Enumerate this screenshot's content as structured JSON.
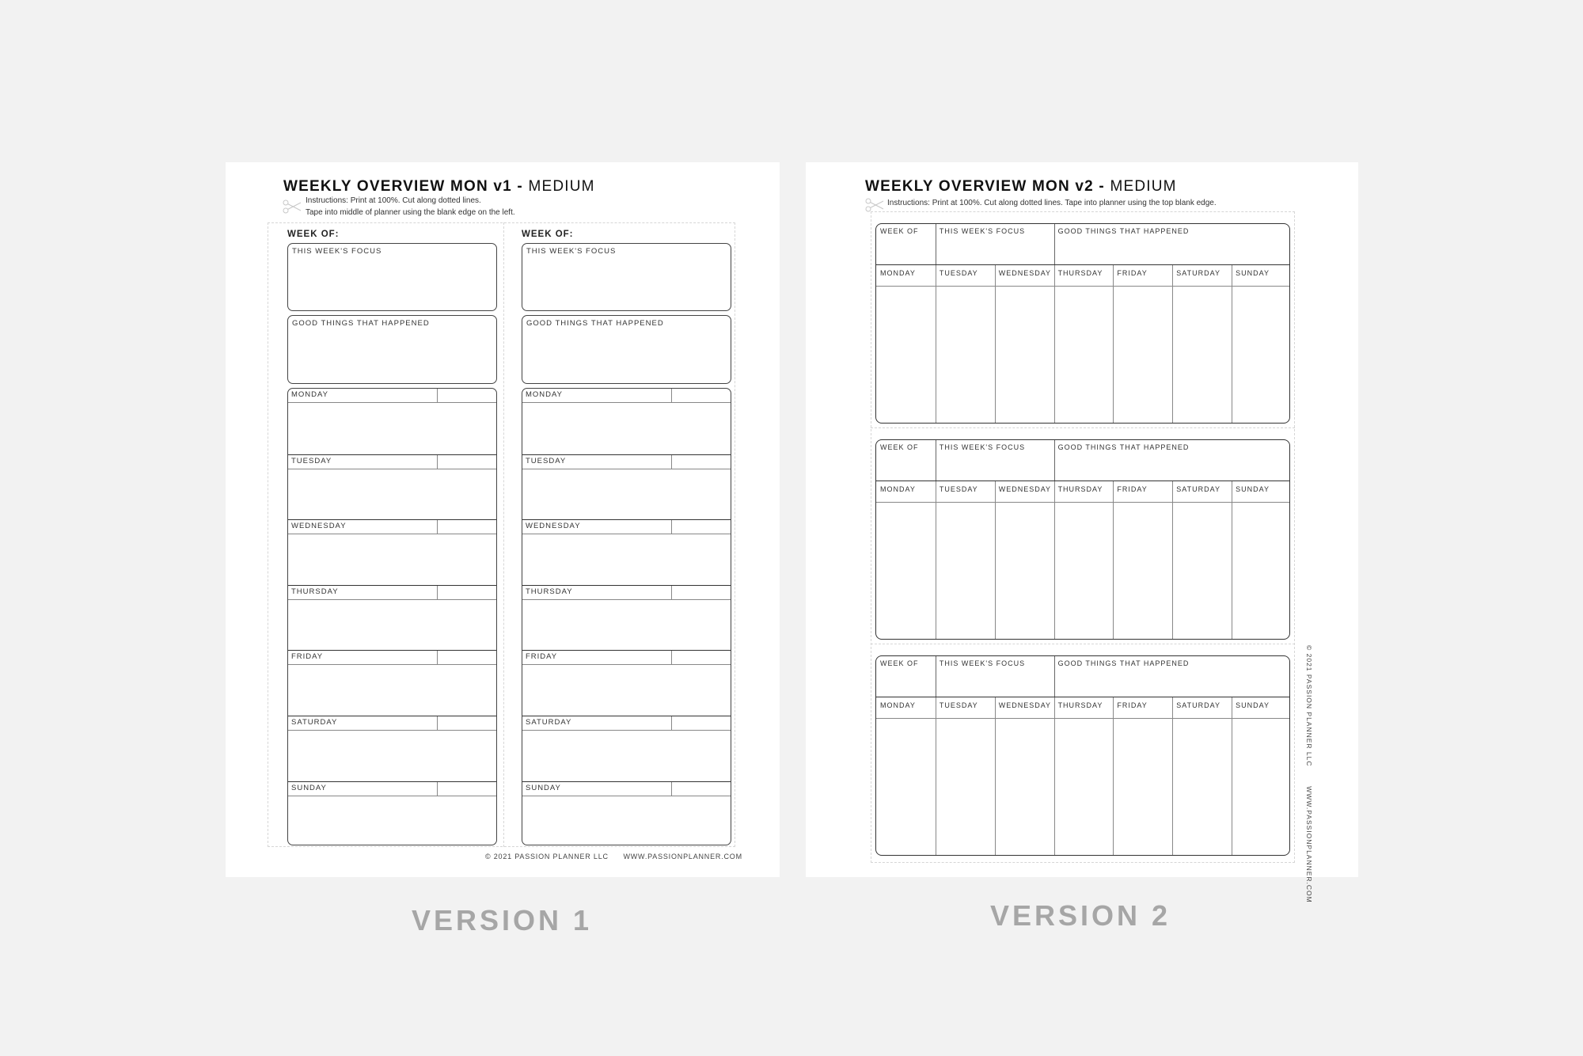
{
  "version1": {
    "title_bold": "WEEKLY OVERVIEW MON v1",
    "title_dash": " - ",
    "title_size": "MEDIUM",
    "instructions_line1": "Instructions: Print at 100%. Cut along dotted lines.",
    "instructions_line2": "Tape into middle of planner using the blank edge on the left.",
    "columns": [
      {
        "week_of": "WEEK OF:",
        "focus_label": "THIS WEEK'S FOCUS",
        "good_things_label": "GOOD THINGS THAT HAPPENED",
        "days": [
          "MONDAY",
          "TUESDAY",
          "WEDNESDAY",
          "THURSDAY",
          "FRIDAY",
          "SATURDAY",
          "SUNDAY"
        ]
      },
      {
        "week_of": "WEEK OF:",
        "focus_label": "THIS WEEK'S FOCUS",
        "good_things_label": "GOOD THINGS THAT HAPPENED",
        "days": [
          "MONDAY",
          "TUESDAY",
          "WEDNESDAY",
          "THURSDAY",
          "FRIDAY",
          "SATURDAY",
          "SUNDAY"
        ]
      }
    ],
    "footer_copyright": "© 2021 PASSION PLANNER LLC",
    "footer_url": "WWW.PASSIONPLANNER.COM",
    "caption": "VERSION 1"
  },
  "version2": {
    "title_bold": "WEEKLY OVERVIEW MON v2",
    "title_dash": " - ",
    "title_size": "MEDIUM",
    "instructions": "Instructions: Print at 100%. Cut along dotted lines. Tape into planner using the top blank edge.",
    "blocks": [
      {
        "week_of": "WEEK OF",
        "focus_label": "THIS WEEK'S FOCUS",
        "good_things_label": "GOOD THINGS THAT HAPPENED",
        "days": [
          "MONDAY",
          "TUESDAY",
          "WEDNESDAY",
          "THURSDAY",
          "FRIDAY",
          "SATURDAY",
          "SUNDAY"
        ]
      },
      {
        "week_of": "WEEK OF",
        "focus_label": "THIS WEEK'S FOCUS",
        "good_things_label": "GOOD THINGS THAT HAPPENED",
        "days": [
          "MONDAY",
          "TUESDAY",
          "WEDNESDAY",
          "THURSDAY",
          "FRIDAY",
          "SATURDAY",
          "SUNDAY"
        ]
      },
      {
        "week_of": "WEEK OF",
        "focus_label": "THIS WEEK'S FOCUS",
        "good_things_label": "GOOD THINGS THAT HAPPENED",
        "days": [
          "MONDAY",
          "TUESDAY",
          "WEDNESDAY",
          "THURSDAY",
          "FRIDAY",
          "SATURDAY",
          "SUNDAY"
        ]
      }
    ],
    "footer_copyright": "© 2021 PASSION PLANNER LLC",
    "footer_url": "WWW.PASSIONPLANNER.COM",
    "caption": "VERSION 2"
  },
  "colors": {
    "background": "#f2f2f2",
    "page": "#ffffff",
    "caption": "#a6a6a6",
    "cut_line": "#d6d6d6",
    "ink": "#222222"
  }
}
